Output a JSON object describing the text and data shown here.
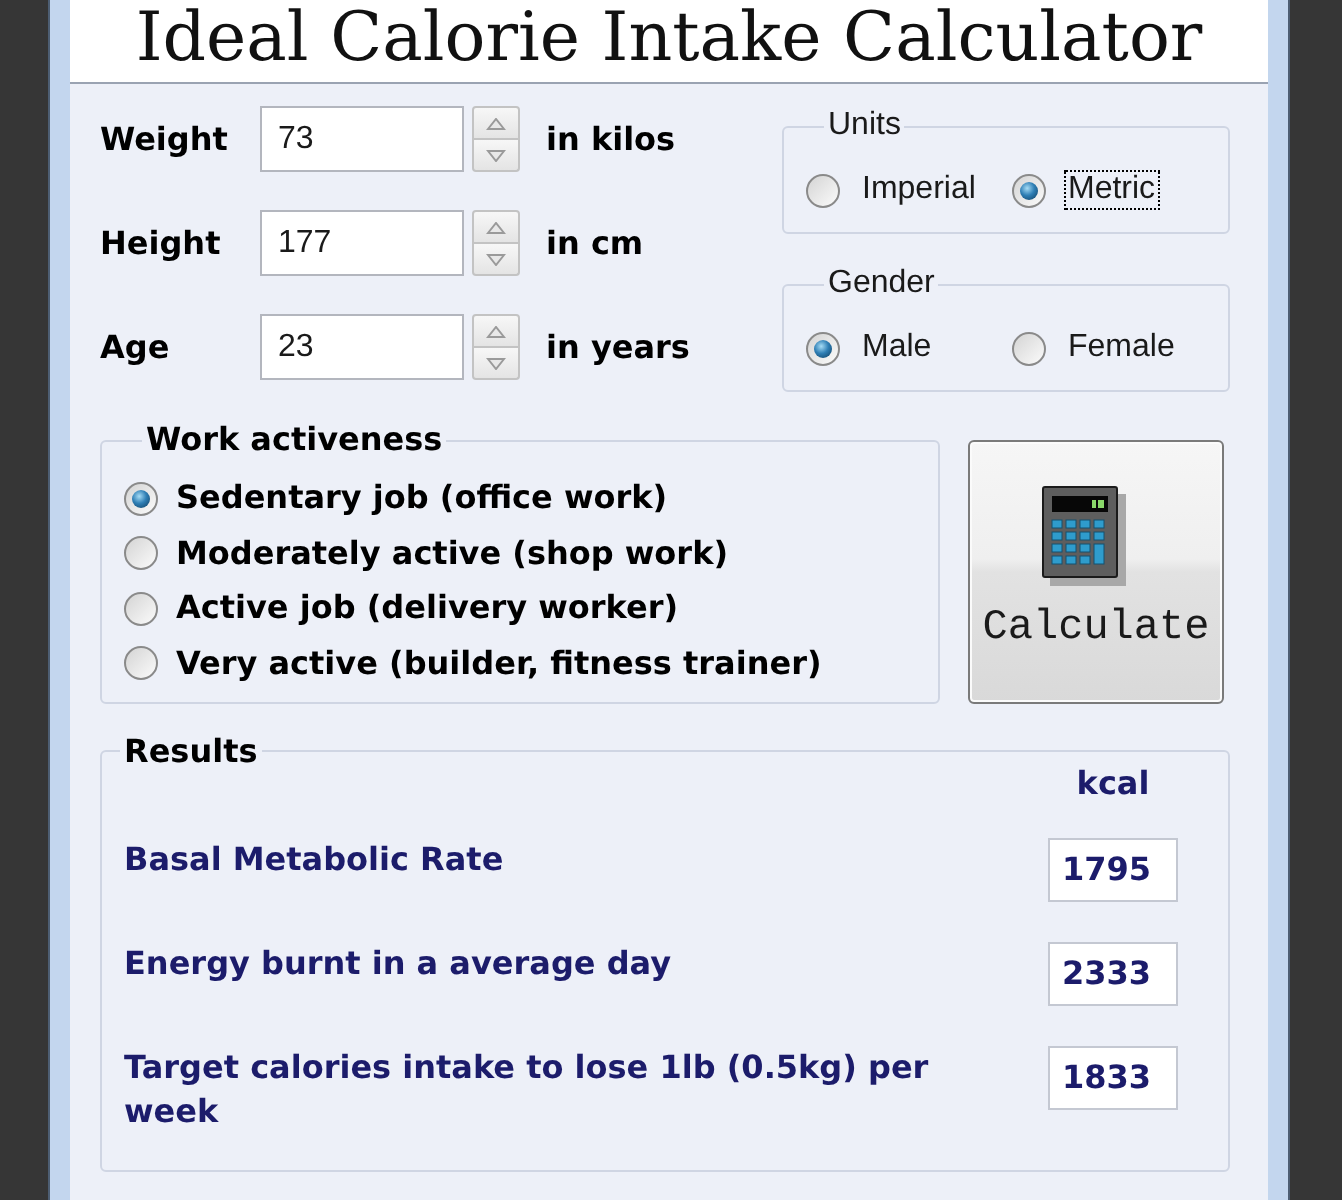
{
  "window": {
    "title": "Ideal Calorie Intake Calculator"
  },
  "measurements": [
    {
      "label": "Weight",
      "value": "73",
      "unit": "in kilos"
    },
    {
      "label": "Height",
      "value": "177",
      "unit": "in cm"
    },
    {
      "label": "Age",
      "value": "23",
      "unit": "in years"
    }
  ],
  "units": {
    "title": "Units",
    "options": [
      {
        "label": "Imperial",
        "selected": false,
        "focused": false
      },
      {
        "label": "Metric",
        "selected": true,
        "focused": true
      }
    ]
  },
  "gender": {
    "title": "Gender",
    "options": [
      {
        "label": "Male",
        "selected": true,
        "focused": false
      },
      {
        "label": "Female",
        "selected": false,
        "focused": false
      }
    ]
  },
  "work_activeness": {
    "title": "Work activeness",
    "options": [
      {
        "label": "Sedentary job (office work)",
        "selected": true
      },
      {
        "label": "Moderately active (shop work)",
        "selected": false
      },
      {
        "label": "Active job (delivery worker)",
        "selected": false
      },
      {
        "label": "Very active (builder, fitness trainer)",
        "selected": false
      }
    ]
  },
  "calculate_button": {
    "label": "Calculate"
  },
  "results": {
    "title": "Results",
    "unit": "kcal",
    "rows": [
      {
        "label": "Basal Metabolic Rate",
        "value": "1795"
      },
      {
        "label": "Energy burnt in a average day",
        "value": "2333"
      },
      {
        "label": "Target calories intake to lose 1lb (0.5kg) per week",
        "value": "1833"
      }
    ]
  }
}
